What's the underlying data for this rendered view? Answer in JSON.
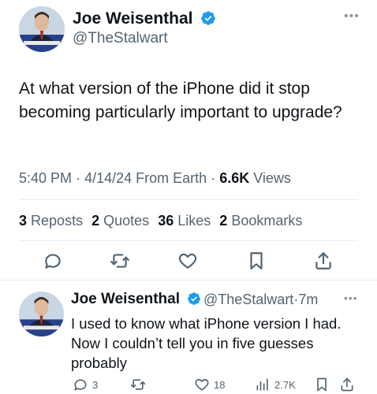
{
  "tweet": {
    "author_name": "Joe Weisenthal",
    "author_handle": "@TheStalwart",
    "text": "At what version of the iPhone did it stop becoming particularly important to upgrade?",
    "time": "5:40 PM",
    "date": "4/14/24",
    "source": "From Earth",
    "views_count": "6.6K",
    "views_label": "Views",
    "reposts_count": "3",
    "reposts_label": "Reposts",
    "quotes_count": "2",
    "quotes_label": "Quotes",
    "likes_count": "36",
    "likes_label": "Likes",
    "bookmarks_count": "2",
    "bookmarks_label": "Bookmarks"
  },
  "reply": {
    "author_name": "Joe Weisenthal",
    "author_handle": "@TheStalwart",
    "age": "7m",
    "text": "I used to know what iPhone version I had. Now I couldn’t tell you in five guesses probably",
    "replies": "3",
    "likes": "18",
    "views": "2.7K"
  },
  "colors": {
    "primary_text": "#0f1419",
    "secondary_text": "#536471",
    "verified_blue": "#1d9bf0",
    "divider": "#e6ecf0"
  },
  "icons": [
    "verified-badge-icon",
    "more-icon",
    "reply-icon",
    "repost-icon",
    "like-icon",
    "bookmark-icon",
    "share-icon",
    "views-icon"
  ]
}
